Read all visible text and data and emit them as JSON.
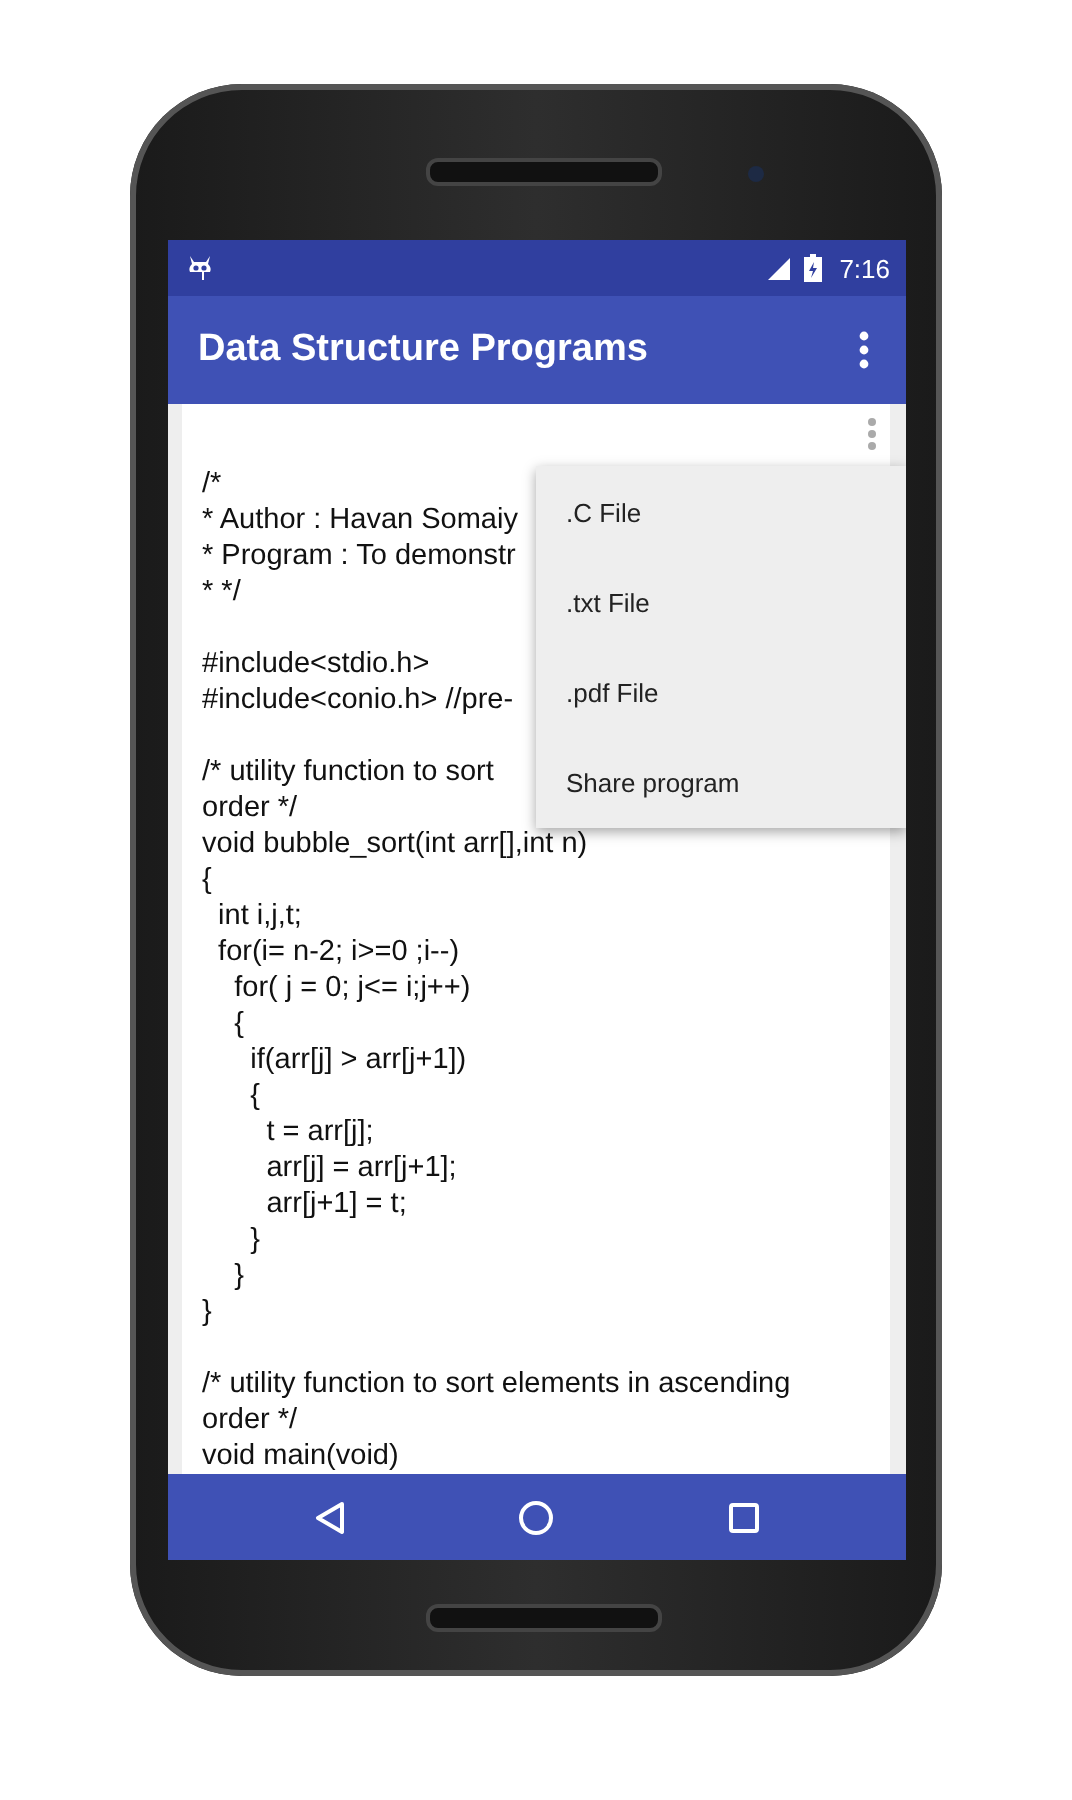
{
  "status_bar": {
    "time": "7:16"
  },
  "app_bar": {
    "title": "Data Structure Programs"
  },
  "code_blocks": [
    [
      "/*",
      "* Author : Havan Somaiy",
      "* Program : To demonstr",
      "* */"
    ],
    [
      "#include<stdio.h>",
      "#include<conio.h> //pre-"
    ],
    [
      "/* utility function to sort",
      "order */",
      "void bubble_sort(int arr[],int n)",
      "{",
      "  int i,j,t;",
      "  for(i= n-2; i>=0 ;i--)",
      "    for( j = 0; j<= i;j++)",
      "    {",
      "      if(arr[j] > arr[j+1])",
      "      {",
      "        t = arr[j];",
      "        arr[j] = arr[j+1];",
      "        arr[j+1] = t;",
      "      }",
      "    }",
      "}"
    ],
    [
      "/* utility function to sort elements in ascending",
      "order */",
      "void main(void)"
    ]
  ],
  "menu": {
    "items": [
      ".C File",
      ".txt File",
      ".pdf File",
      "Share program"
    ]
  }
}
